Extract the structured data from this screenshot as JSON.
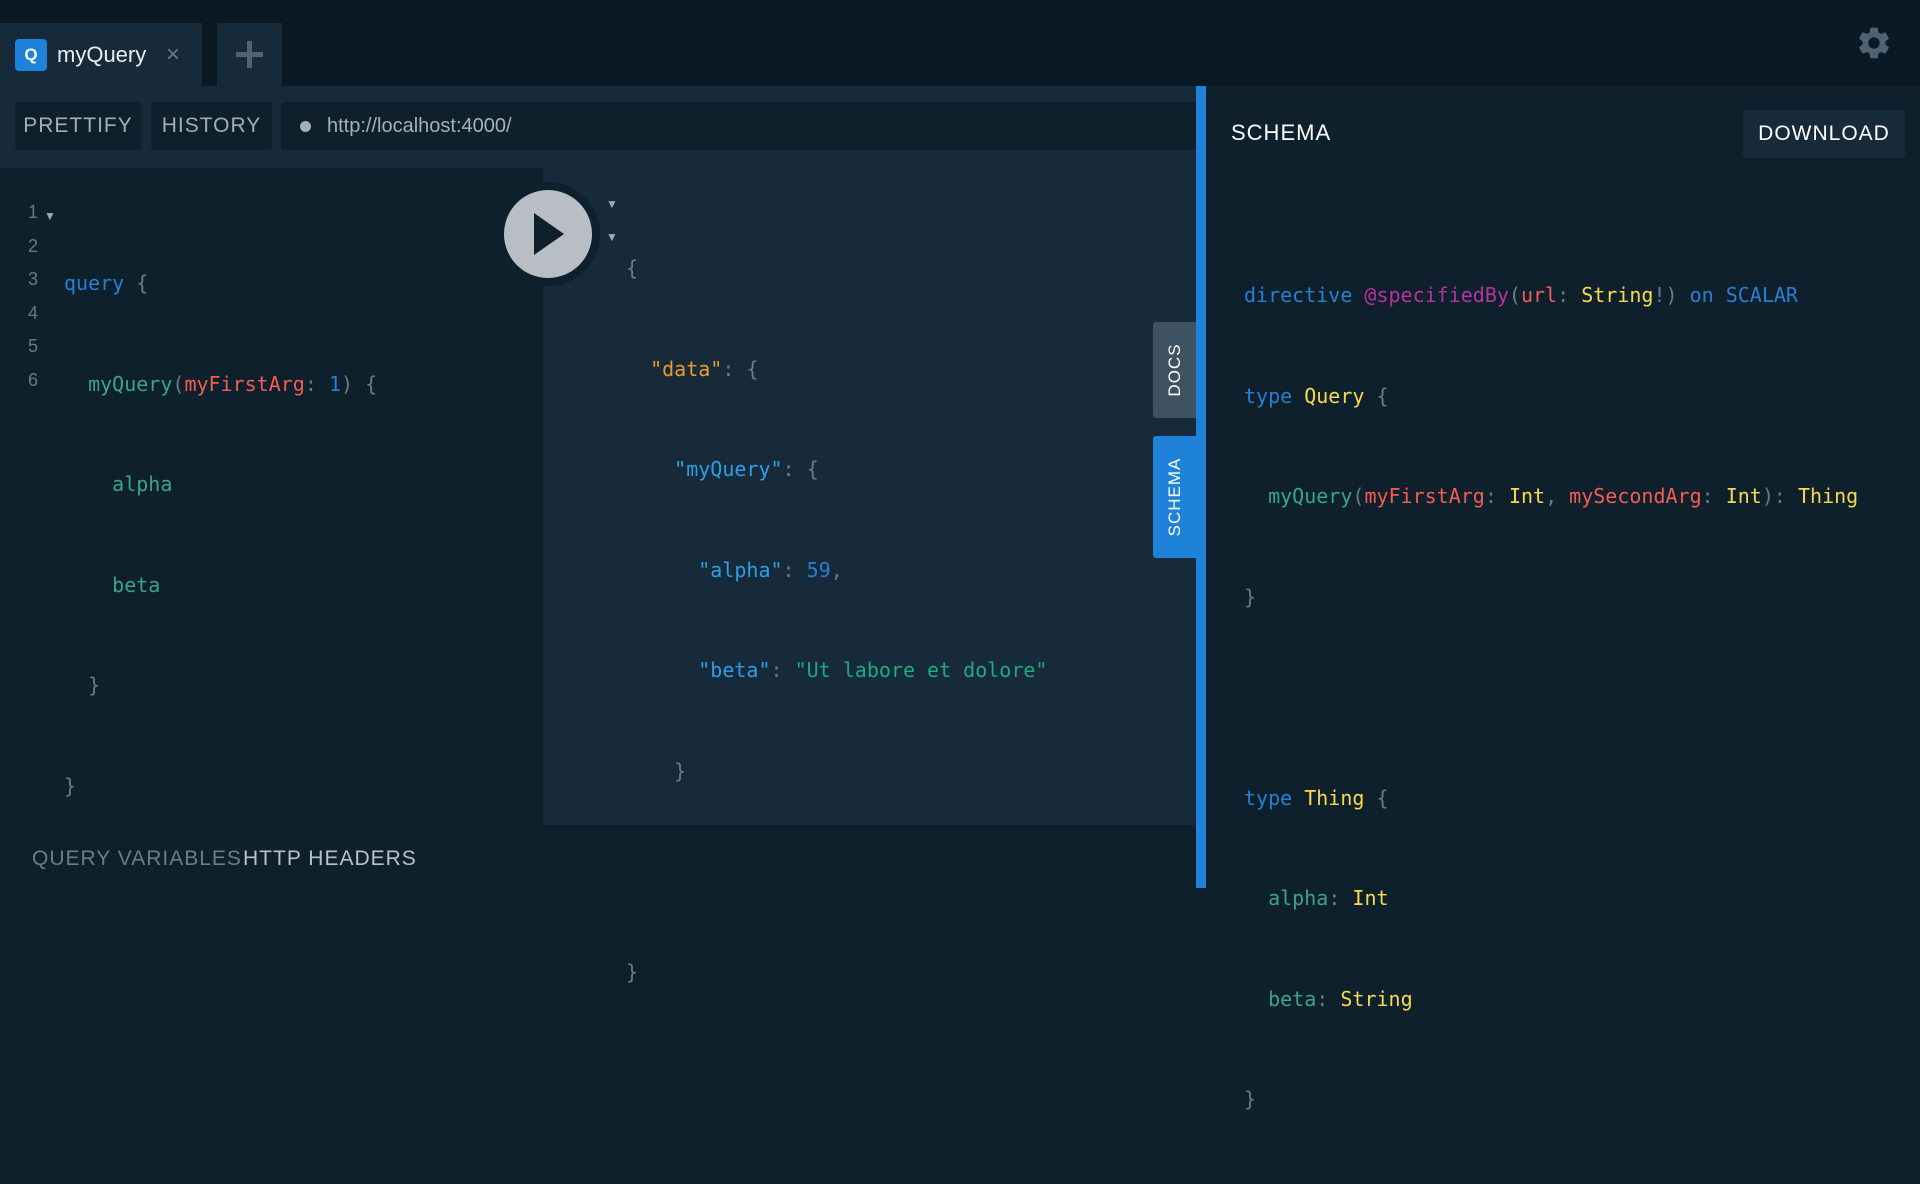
{
  "tabs": [
    {
      "icon_letter": "Q",
      "title": "myQuery",
      "close_glyph": "×"
    }
  ],
  "new_tab_icon": "plus-icon",
  "settings_icon": "gear-icon",
  "toolbar": {
    "prettify": "PRETTIFY",
    "history": "HISTORY",
    "endpoint": "http://localhost:4000/"
  },
  "editor": {
    "line_numbers": [
      "1",
      "2",
      "3",
      "4",
      "5",
      "6"
    ],
    "tokens": {
      "query_kw": "query",
      "open1": "{",
      "field": "myQuery",
      "paren_open": "(",
      "arg_name": "myFirstArg",
      "colon": ": ",
      "arg_val": "1",
      "paren_close": ")",
      "open2": "{",
      "alpha": "alpha",
      "beta": "beta",
      "close2": "}",
      "close1": "}"
    }
  },
  "results": {
    "tokens": {
      "o1": "{",
      "data_key": "\"data\"",
      "c1": ": ",
      "o2": "{",
      "myq_key": "\"myQuery\"",
      "c2": ": ",
      "o3": "{",
      "alpha_key": "\"alpha\"",
      "c3": ": ",
      "alpha_val": "59",
      "comma": ",",
      "beta_key": "\"beta\"",
      "c4": ": ",
      "beta_val": "\"Ut labore et dolore\"",
      "x3": "}",
      "x2": "}",
      "x1": "}"
    }
  },
  "bottom": {
    "query_variables": "QUERY VARIABLES",
    "http_headers": "HTTP HEADERS"
  },
  "side_tabs": {
    "docs": "DOCS",
    "schema": "SCHEMA"
  },
  "schema_panel": {
    "title": "SCHEMA",
    "download": "DOWNLOAD",
    "tokens": {
      "directive_kw": "directive",
      "directive_name": "@specifiedBy",
      "p_open": "(",
      "url_arg": "url",
      "colon": ": ",
      "string_t": "String",
      "bang": "!",
      "p_close": ")",
      "on_kw": "on",
      "scalar_kw": "SCALAR",
      "type_kw": "type",
      "query_t": "Query",
      "brace_o": "{",
      "myquery_f": "myQuery",
      "arg1": "myFirstArg",
      "int_t": "Int",
      "comma_sp": ", ",
      "arg2": "mySecondArg",
      "thing_t": "Thing",
      "brace_c": "}",
      "thing_name": "Thing",
      "alpha_f": "alpha",
      "beta_f": "beta"
    }
  },
  "colors": {
    "accent": "#1e82d8",
    "background": "#0f202d",
    "panel": "#172a3a"
  }
}
